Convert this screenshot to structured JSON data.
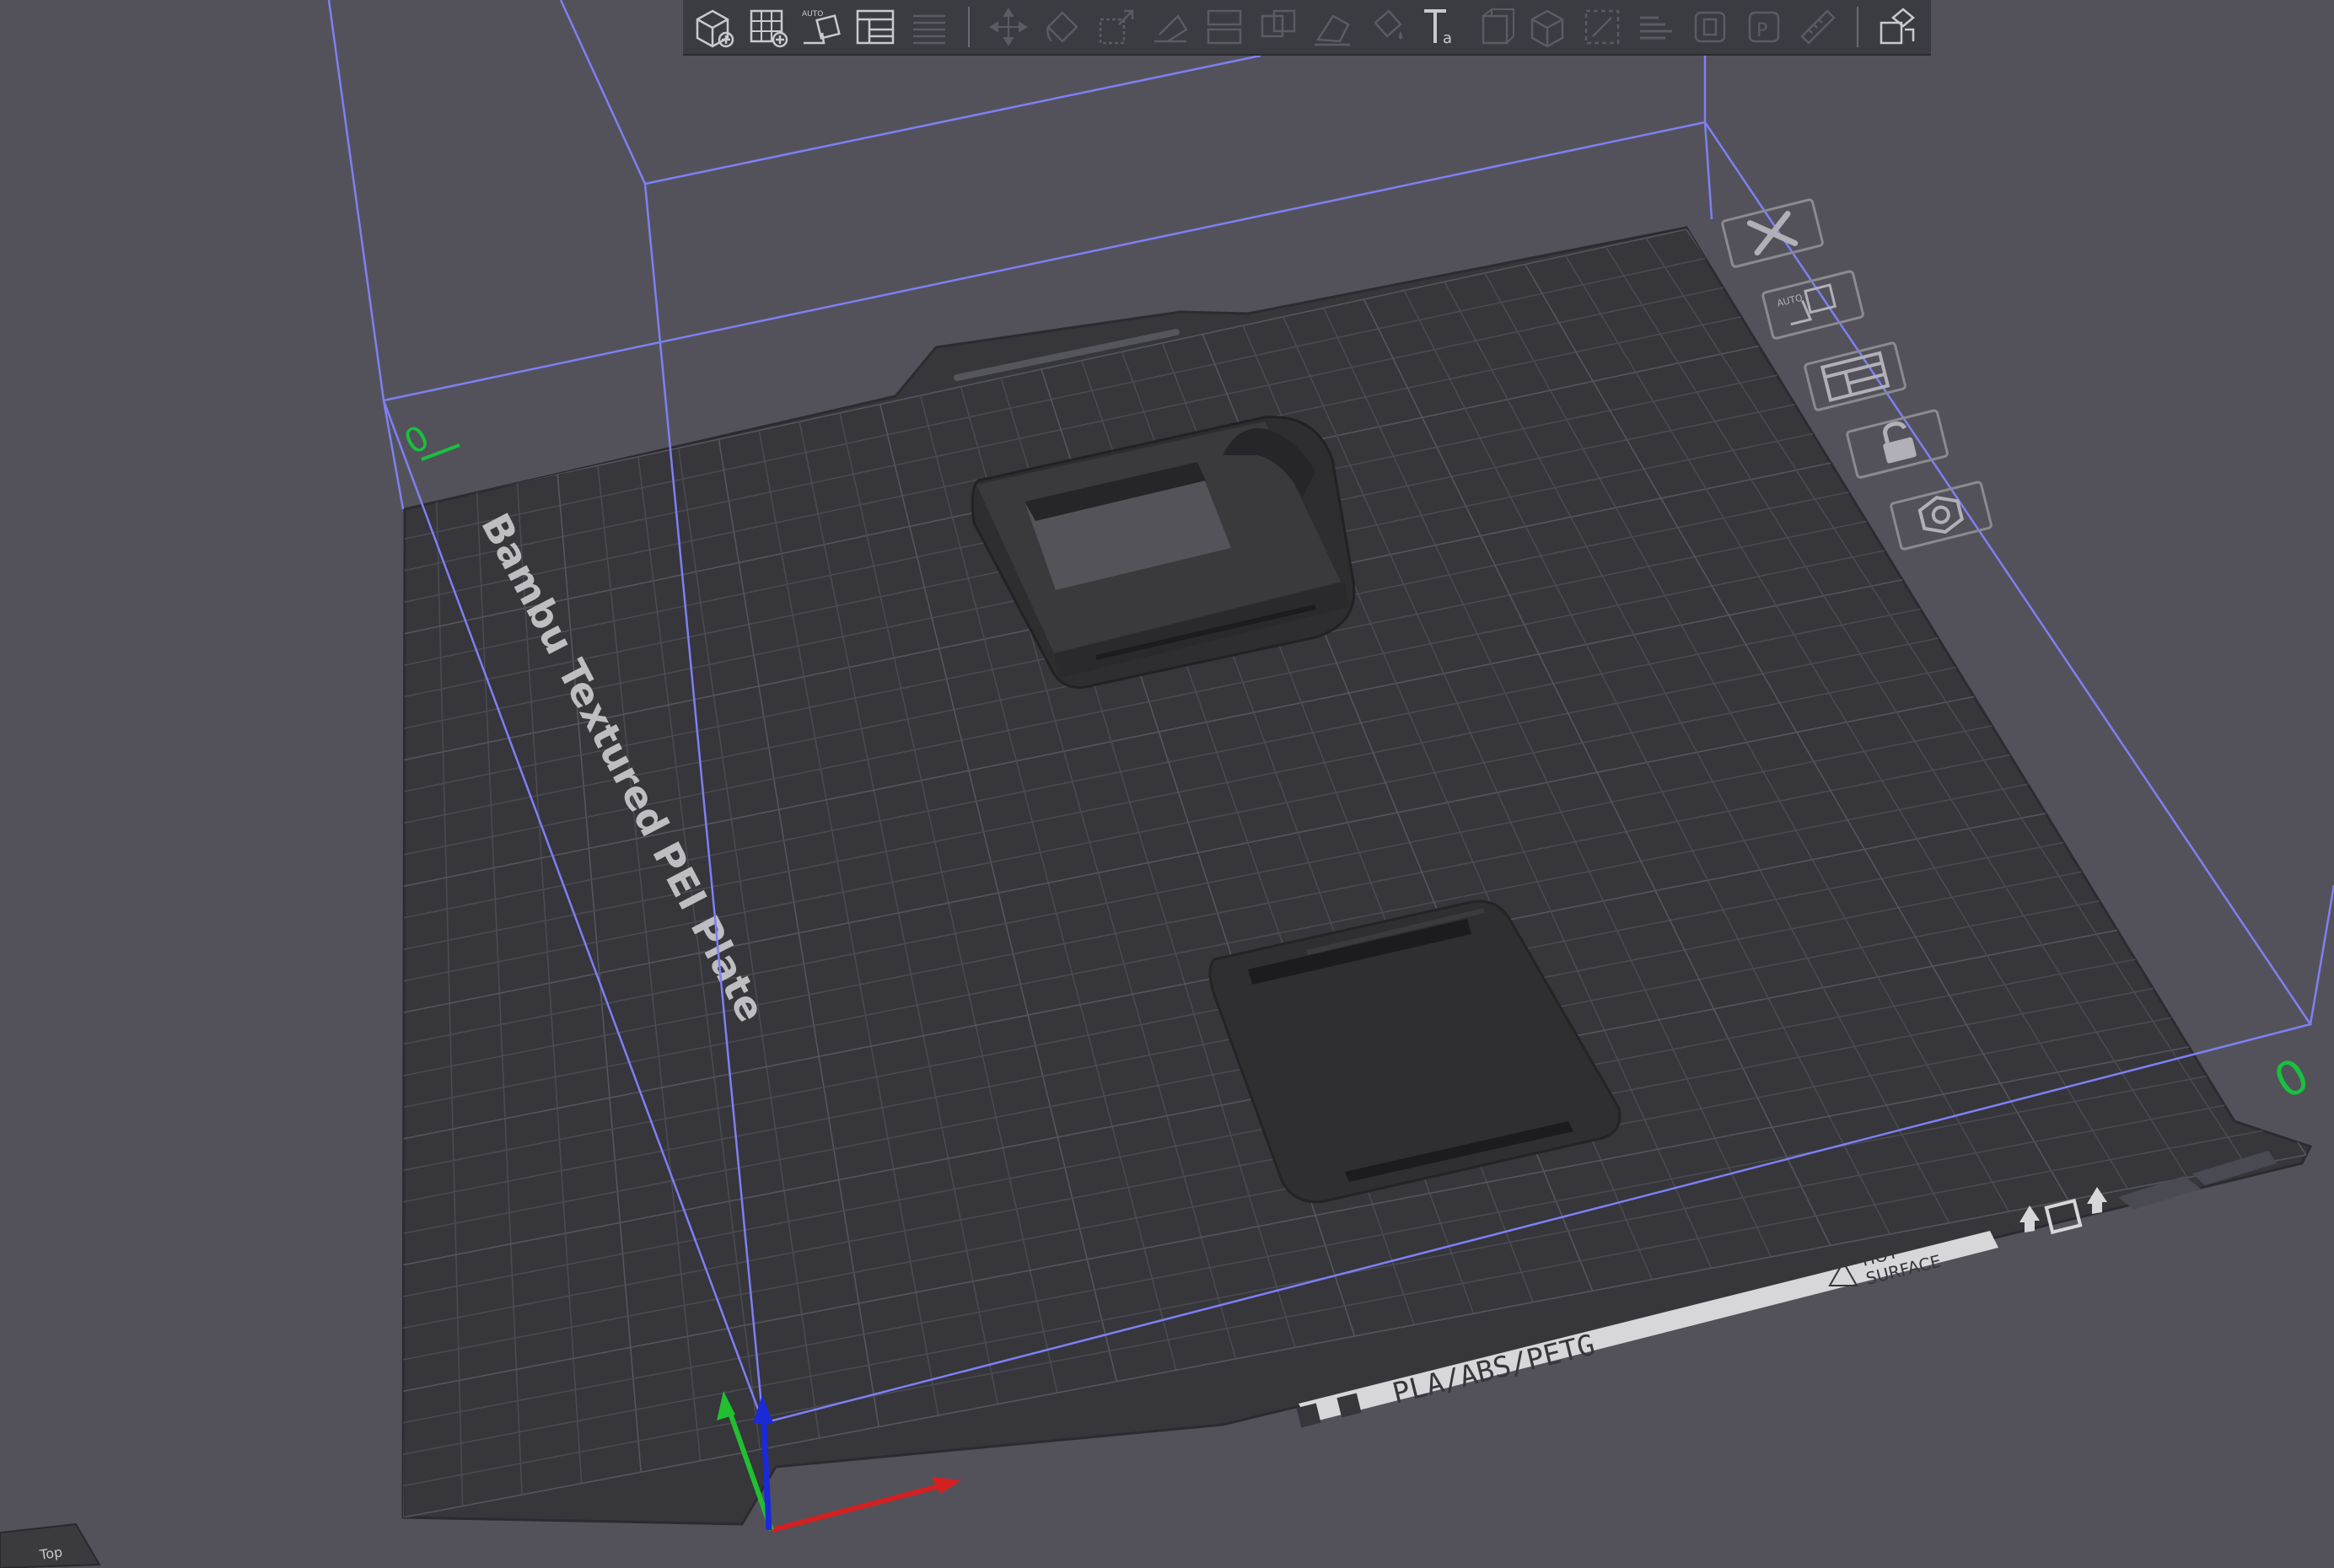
{
  "app": {
    "view_cube_label": "Top"
  },
  "plate": {
    "name": "Bambu Textured PEI Plate",
    "material_label": "PLA/ABS/PETG",
    "warning_label_line1": "HOT",
    "warning_label_line2": "SURFACE",
    "plate_index_left": "0",
    "plate_index_right": "0"
  },
  "toolbar": {
    "items": [
      {
        "icon": "add-object-icon",
        "enabled": true
      },
      {
        "icon": "add-plate-icon",
        "enabled": true
      },
      {
        "icon": "auto-orient-icon",
        "enabled": true
      },
      {
        "icon": "arrange-icon",
        "enabled": true
      },
      {
        "icon": "split-layers-icon",
        "enabled": false
      },
      {
        "icon": "move-icon",
        "enabled": false
      },
      {
        "icon": "rotate-icon",
        "enabled": false
      },
      {
        "icon": "scale-icon",
        "enabled": false
      },
      {
        "icon": "lay-on-face-icon",
        "enabled": false
      },
      {
        "icon": "cut-icon",
        "enabled": false
      },
      {
        "icon": "boolean-icon",
        "enabled": false
      },
      {
        "icon": "support-paint-icon",
        "enabled": false
      },
      {
        "icon": "color-paint-icon",
        "enabled": false
      },
      {
        "icon": "text-icon",
        "enabled": true
      },
      {
        "icon": "seam-paint-icon",
        "enabled": false
      },
      {
        "icon": "split-object-icon",
        "enabled": false
      },
      {
        "icon": "measure-icon",
        "enabled": false
      },
      {
        "icon": "variable-layer-icon",
        "enabled": false
      },
      {
        "icon": "assembly-icon",
        "enabled": false
      },
      {
        "icon": "parts-icon",
        "enabled": false
      },
      {
        "icon": "ruler-icon",
        "enabled": false
      },
      {
        "icon": "assembly-view-icon",
        "enabled": true
      }
    ]
  },
  "plate_tools": [
    {
      "name": "delete-plate-button",
      "icon": "close-icon"
    },
    {
      "name": "auto-orient-plate-button",
      "icon": "auto-orient-icon"
    },
    {
      "name": "arrange-plate-button",
      "icon": "arrange-icon"
    },
    {
      "name": "lock-plate-button",
      "icon": "lock-icon"
    },
    {
      "name": "plate-settings-button",
      "icon": "hexagon-settings-icon"
    }
  ],
  "objects": [
    {
      "name": "housing-frame"
    },
    {
      "name": "slide-cover"
    }
  ],
  "colors": {
    "background": "#53525a",
    "plate": "#36363b",
    "plate_grid": "#4a4a52",
    "build_volume": "#7f7ff5",
    "axis_x": "#d42020",
    "axis_y": "#20c030",
    "axis_z": "#1a2ad8",
    "model": "#2e2e30",
    "plate_index": "#17c23d"
  }
}
